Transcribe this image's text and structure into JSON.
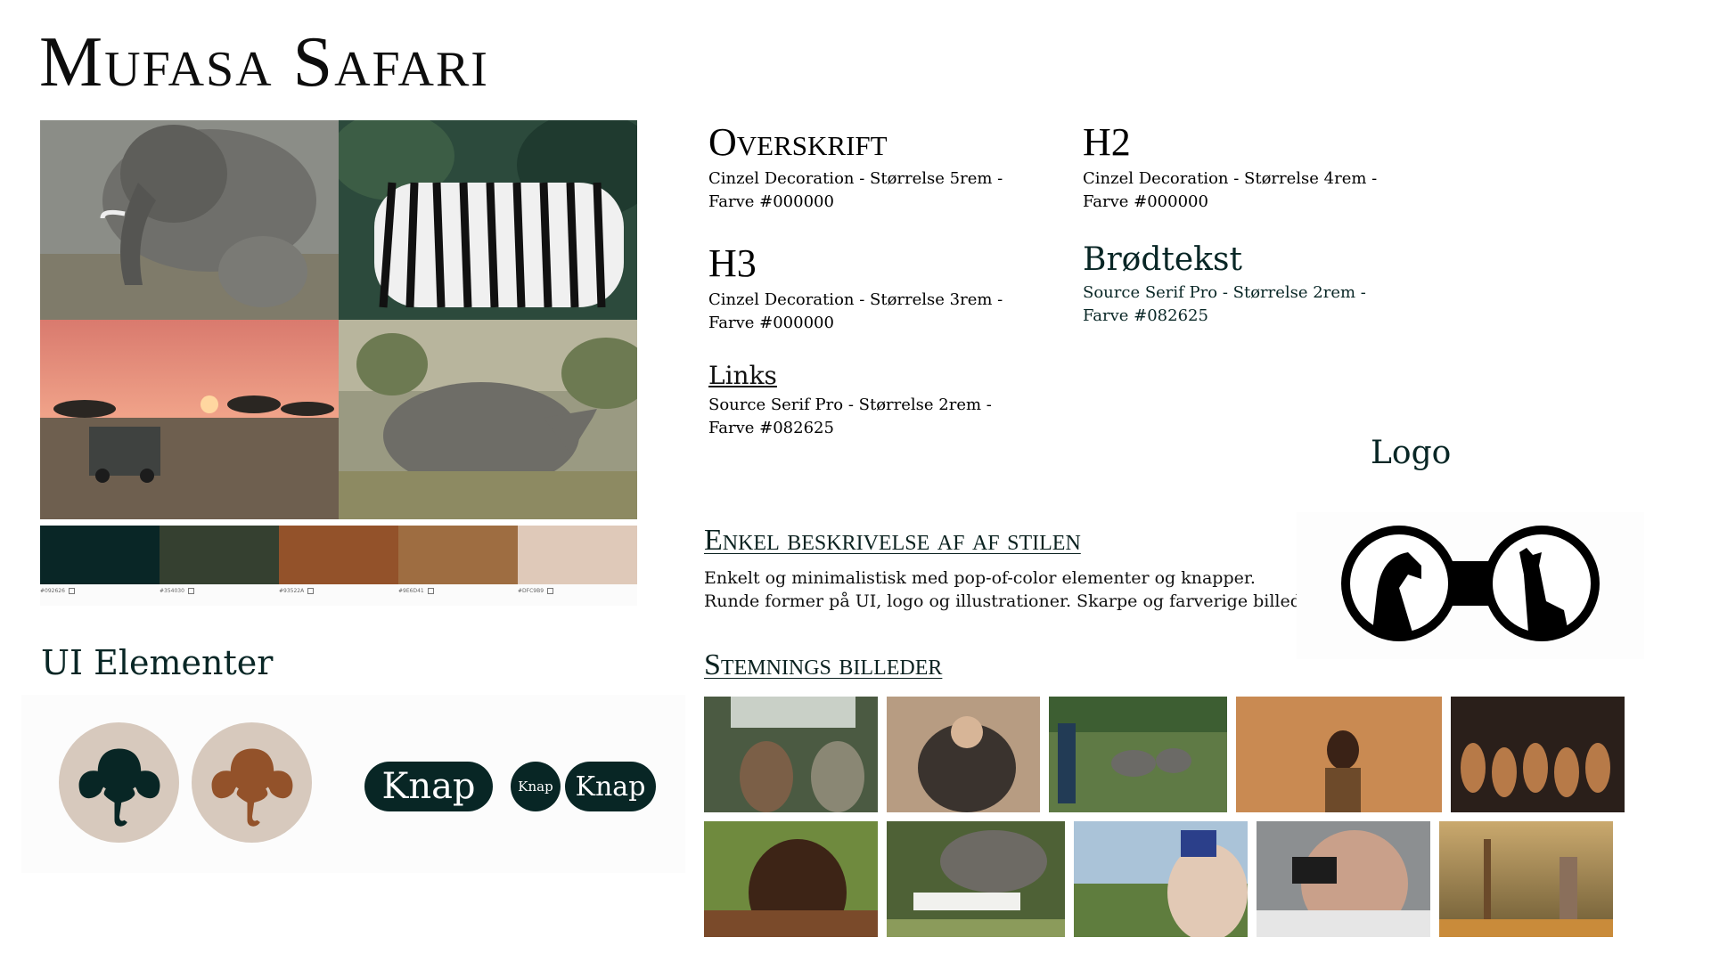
{
  "title": "Mufasa Safari",
  "palette": [
    {
      "hex": "#092626",
      "label": "#092626"
    },
    {
      "hex": "#354030",
      "label": "#354030"
    },
    {
      "hex": "#93522A",
      "label": "#93522A"
    },
    {
      "hex": "#9E6D41",
      "label": "#9E6D41"
    },
    {
      "hex": "#DFC9B9",
      "label": "#DFC9B9"
    }
  ],
  "typography": {
    "h1": {
      "sample": "Overskrift",
      "desc": "Cinzel Decoration - Størrelse 5rem - Farve #000000"
    },
    "h2": {
      "sample": "H2",
      "desc": "Cinzel Decoration - Størrelse 4rem - Farve #000000"
    },
    "h3": {
      "sample": "H3",
      "desc": "Cinzel Decoration - Størrelse 3rem - Farve #000000"
    },
    "body": {
      "sample": "Brødtekst",
      "desc": "Source Serif Pro - Størrelse 2rem - Farve #082625"
    },
    "links": {
      "sample": "Links",
      "desc": "Source Serif Pro - Størrelse 2rem - Farve #082625"
    }
  },
  "style": {
    "heading": "Enkel beskrivelse af af stilen",
    "line1": "Enkelt og minimalistisk med pop-of-color elementer og knapper.",
    "line2": "Runde former på UI, logo og illustrationer. Skarpe og farverige billeder."
  },
  "logo": {
    "label": "Logo"
  },
  "mood": {
    "heading": "Stemnings billeder"
  },
  "ui": {
    "heading": "UI Elementer",
    "button_large": "Knap",
    "button_small": "Knap",
    "button_medium": "Knap"
  },
  "colors": {
    "brand": "#082625",
    "accent": "#93522A",
    "sand": "#d7c9bd"
  }
}
